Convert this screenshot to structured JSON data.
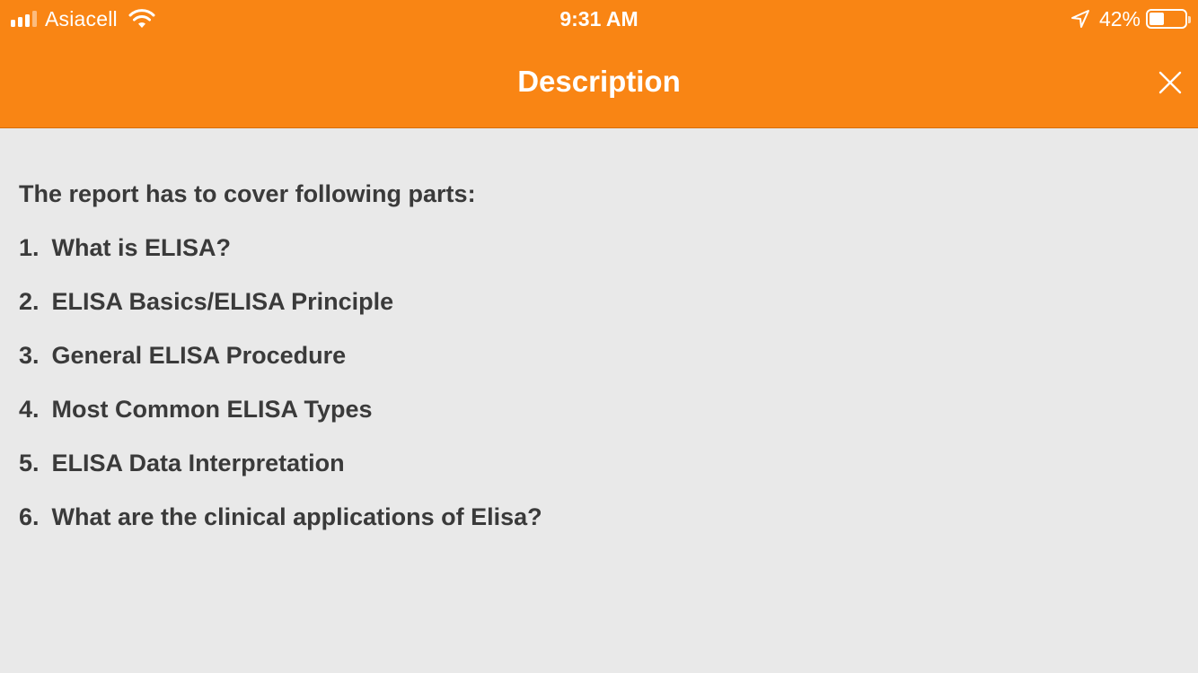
{
  "status_bar": {
    "carrier": "Asiacell",
    "time": "9:31 AM",
    "battery_percent": "42%",
    "battery_level": 0.42,
    "icons": [
      "signal-bars-icon",
      "wifi-icon",
      "location-arrow-icon",
      "battery-icon"
    ]
  },
  "nav": {
    "title": "Description",
    "close_icon": "close-icon",
    "accent_color": "#f98514"
  },
  "content": {
    "intro": "The report has to cover following parts:",
    "items": [
      {
        "number": "1.",
        "text": "What is ELISA?"
      },
      {
        "number": "2.",
        "text": "ELISA Basics/ELISA Principle"
      },
      {
        "number": "3.",
        "text": "General ELISA Procedure"
      },
      {
        "number": "4.",
        "text": "Most Common ELISA Types"
      },
      {
        "number": "5.",
        "text": "ELISA Data Interpretation"
      },
      {
        "number": "6.",
        "text": "What are the clinical applications of Elisa?"
      }
    ]
  }
}
